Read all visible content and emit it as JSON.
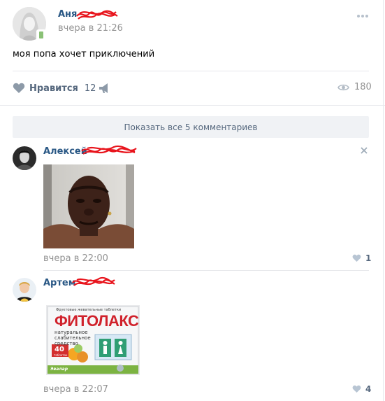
{
  "post": {
    "author": "Аня",
    "time": "вчера в 21:26",
    "text": "моя попа хочет приключений",
    "like_label": "Нравится",
    "likes": "12",
    "views": "180"
  },
  "comments_bar": {
    "label": "Показать все 5 комментариев"
  },
  "comments": [
    {
      "author": "Алексей",
      "time": "вчера в 22:00",
      "likes": "1"
    },
    {
      "author": "Артем",
      "time": "вчера в 22:07",
      "likes": "4"
    }
  ],
  "product": {
    "top_line": "Фруктовые жевательные таблетки",
    "brand": "ФИТОЛАКС",
    "desc_1": "натуральное",
    "desc_2": "слабительное",
    "desc_3": "средство",
    "count": "40",
    "count_unit": "таблеток",
    "maker": "Эвалар"
  },
  "colors": {
    "link": "#2a5885",
    "muted": "#939393",
    "divider": "#e7e8ec",
    "bar_bg": "#f0f2f5",
    "icon": "#8d9aa8",
    "scribble": "#e8141c"
  }
}
